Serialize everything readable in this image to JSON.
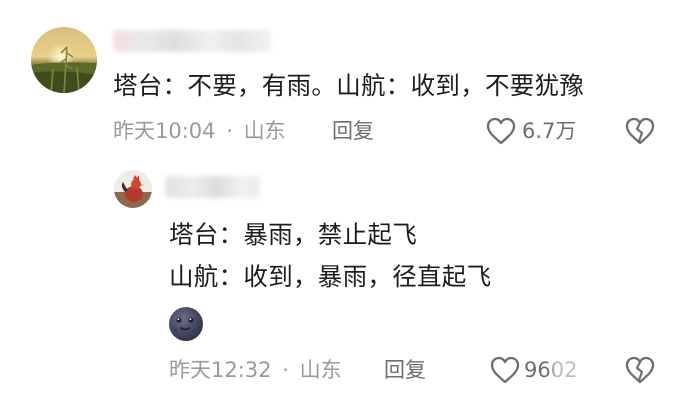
{
  "comment": {
    "text": "塔台：不要，有雨。山航：收到，不要犹豫",
    "time": "昨天10:04",
    "separator": "·",
    "location": "山东",
    "reply_label": "回复",
    "likes": "6.7万",
    "avatar": "avatar-sunset-field"
  },
  "reply": {
    "line1": "塔台：暴雨，禁止起飞",
    "line2": "山航：收到，暴雨，径直起飞",
    "emoji": "moon-face-emoji",
    "time": "昨天12:32",
    "separator": "·",
    "location": "山东",
    "reply_label": "回复",
    "likes": "9602",
    "avatar": "avatar-rooster"
  },
  "colors": {
    "text": "#1c1c1c",
    "meta": "#9a9a9a",
    "icon": "#6e6e6e"
  }
}
